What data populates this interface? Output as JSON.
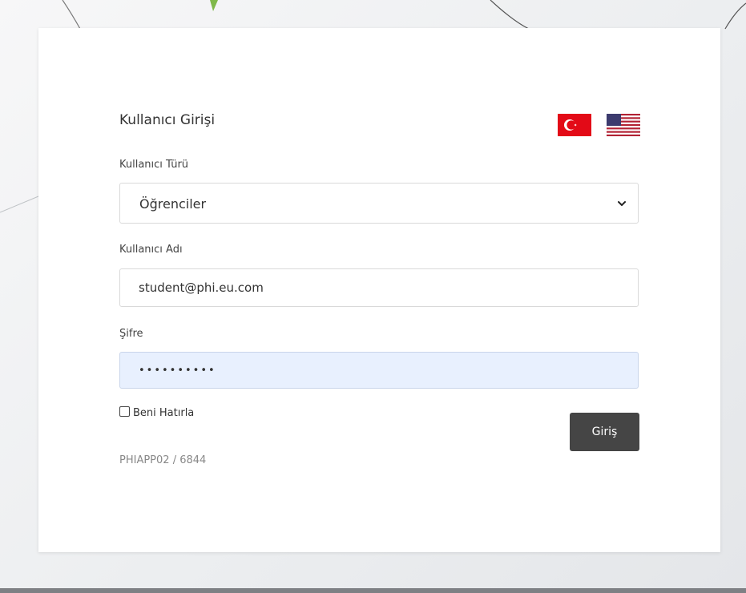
{
  "login": {
    "title": "Kullanıcı Girişi",
    "user_type_label": "Kullanıcı Türü",
    "user_type_value": "Öğrenciler",
    "username_label": "Kullanıcı Adı",
    "username_value": "student@phi.eu.com",
    "password_label": "Şifre",
    "password_value": "••••••••••",
    "remember_label": "Beni Hatırla",
    "submit_label": "Giriş",
    "version": "PHIAPP02 / 6844"
  },
  "languages": [
    {
      "icon": "turkish-flag-icon"
    },
    {
      "icon": "us-flag-icon"
    }
  ],
  "colors": {
    "button_bg": "#454545",
    "password_autofill_bg": "#e8f0fe",
    "flag_red": "#e30a17"
  }
}
